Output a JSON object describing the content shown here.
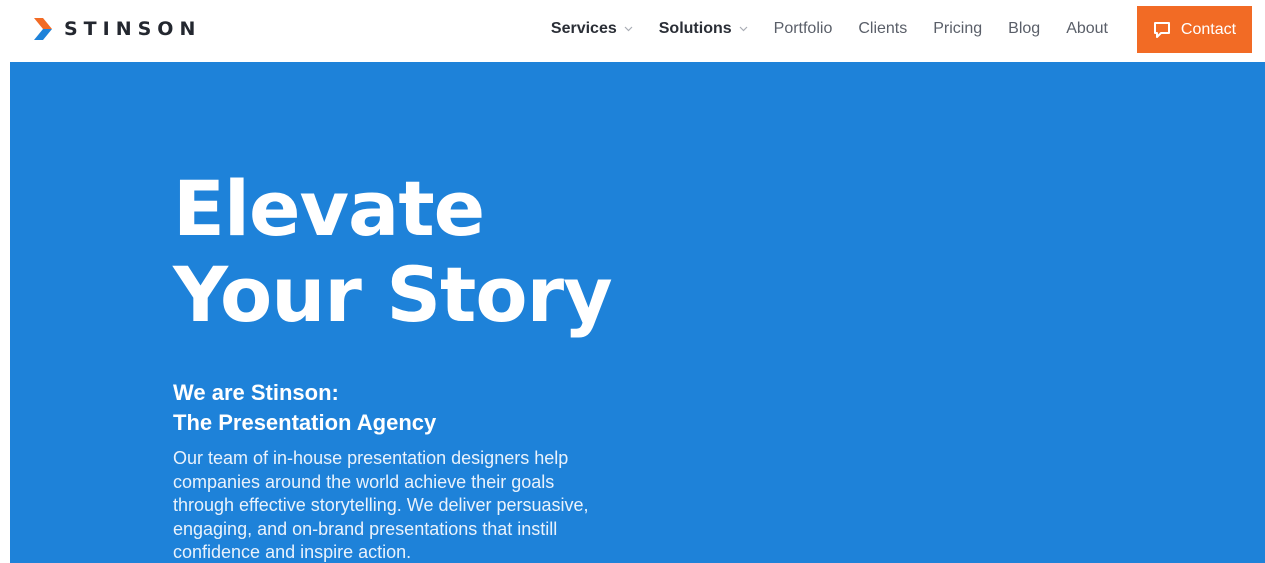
{
  "brand": {
    "name": "STINSON",
    "accent_color": "#f26b25",
    "logo_icon": "chevron-logo-icon"
  },
  "nav": {
    "items": [
      {
        "label": "Services",
        "has_dropdown": true
      },
      {
        "label": "Solutions",
        "has_dropdown": true
      },
      {
        "label": "Portfolio",
        "has_dropdown": false
      },
      {
        "label": "Clients",
        "has_dropdown": false
      },
      {
        "label": "Pricing",
        "has_dropdown": false
      },
      {
        "label": "Blog",
        "has_dropdown": false
      },
      {
        "label": "About",
        "has_dropdown": false
      }
    ],
    "contact": {
      "label": "Contact",
      "icon": "chat-bubble-icon",
      "color": "#f26b25"
    }
  },
  "hero": {
    "background_color": "#1e82d9",
    "title_line1": "Elevate",
    "title_line2": "Your Story",
    "subtitle_line1": "We are Stinson:",
    "subtitle_line2": "The Presentation Agency",
    "body_lines": [
      "Our team of in-house presentation designers help",
      "companies around the world achieve their goals",
      "through effective storytelling. We deliver persuasive,",
      "engaging, and on-brand presentations that instill",
      "confidence and inspire action."
    ]
  }
}
